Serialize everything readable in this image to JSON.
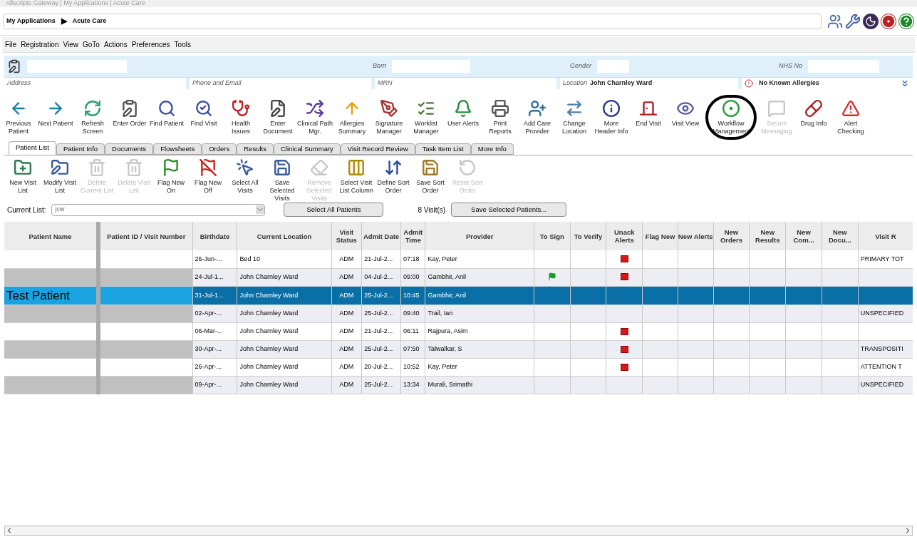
{
  "window": {
    "title": "Allscripts Gateway | My Applications | Acute Care"
  },
  "breadcrumb": {
    "items": [
      "My Applications",
      "Acute Care"
    ],
    "separator": "▶"
  },
  "menu": [
    "File",
    "Registration",
    "View",
    "GoTo",
    "Actions",
    "Preferences",
    "Tools"
  ],
  "patient_header": {
    "row_1": [
      {
        "label": "Born"
      },
      {
        "label": "Gender"
      },
      {
        "label": "NHS No"
      }
    ],
    "row_2": [
      {
        "label": "Address"
      },
      {
        "label": "Phone and Email"
      },
      {
        "label": "MRN"
      },
      {
        "label": "Location",
        "value": "John Charnley Ward"
      }
    ],
    "allergies": "No Known Allergies"
  },
  "toolbar": [
    {
      "label": "Previous Patient",
      "disabled": false
    },
    {
      "label": "Next Patient",
      "disabled": false
    },
    {
      "label": "Refresh Screen",
      "disabled": false
    },
    {
      "label": "Enter Order",
      "disabled": false
    },
    {
      "label": "Find Patient",
      "disabled": false
    },
    {
      "label": "Find Visit",
      "disabled": false
    },
    {
      "label": "Health Issues",
      "disabled": false
    },
    {
      "label": "Enter Document",
      "disabled": false
    },
    {
      "label": "Clinical Path Mgr.",
      "disabled": false
    },
    {
      "label": "Allergies Summary",
      "disabled": false
    },
    {
      "label": "Signature Manager",
      "disabled": false
    },
    {
      "label": "Worklist Manager",
      "disabled": false
    },
    {
      "label": "User Alerts",
      "disabled": false
    },
    {
      "label": "Print Reports",
      "disabled": false
    },
    {
      "label": "Add Care Provider",
      "disabled": false
    },
    {
      "label": "Change Location",
      "disabled": false
    },
    {
      "label": "More Header Info",
      "disabled": false
    },
    {
      "label": "End Visit",
      "disabled": false
    },
    {
      "label": "Visit View",
      "disabled": false
    },
    {
      "label": "Workflow Management",
      "disabled": false
    },
    {
      "label": "Secure Messaging",
      "disabled": true
    },
    {
      "label": "Drug Info",
      "disabled": false
    },
    {
      "label": "Alert Checking",
      "disabled": false
    }
  ],
  "tabs": [
    {
      "label": "Patient List",
      "selected": true
    },
    {
      "label": "Patient Info",
      "selected": false
    },
    {
      "label": "Documents",
      "selected": false
    },
    {
      "label": "Flowsheets",
      "selected": false
    },
    {
      "label": "Orders",
      "selected": false
    },
    {
      "label": "Results",
      "selected": false
    },
    {
      "label": "Clinical Summary",
      "selected": false
    },
    {
      "label": "Visit Record Review",
      "selected": false
    },
    {
      "label": "Task Item List",
      "selected": false
    },
    {
      "label": "More Info",
      "selected": false
    }
  ],
  "list_toolbar": [
    {
      "label": "New Visit List",
      "disabled": false
    },
    {
      "label": "Modify Visit List",
      "disabled": false
    },
    {
      "label": "Delete Current List",
      "disabled": true
    },
    {
      "label": "Delete Visit List",
      "disabled": true
    },
    {
      "label": "Flag New On",
      "disabled": false
    },
    {
      "label": "Flag New Off",
      "disabled": false
    },
    {
      "label": "Select All Visits",
      "disabled": false
    },
    {
      "label": "Save Selected Visits",
      "disabled": false
    },
    {
      "label": "Remove Selected Visits",
      "disabled": true
    },
    {
      "label": "Select Visit List Column",
      "disabled": false
    },
    {
      "label": "Define Sort Order",
      "disabled": false
    },
    {
      "label": "Save Sort Order",
      "disabled": false
    },
    {
      "label": "Reset Sort Order",
      "disabled": true
    }
  ],
  "current_list": {
    "label": "Current List:",
    "value": "jcw"
  },
  "select_all_button": "Select All Patients",
  "visit_count": "8 Visit(s)",
  "save_selected_button": "Save Selected Patients...",
  "table": {
    "columns": [
      "Patient Name",
      "Patient ID / Visit Number",
      "Birthdate",
      "Current Location",
      "Visit Status",
      "Admit Date",
      "Admit Time",
      "Provider",
      "To Sign",
      "To Verify",
      "Unack Alerts",
      "Flag New",
      "New Alerts",
      "New Orders",
      "New Results",
      "New Com...",
      "New Docu...",
      "Visit R"
    ],
    "rows": [
      {
        "selected": false,
        "birthdate": "26-Jun-...",
        "location": "Bed 10",
        "status": "ADM",
        "admit_date": "21-Jul-2...",
        "admit_time": "07:18",
        "provider": "Kay, Peter",
        "to_sign": false,
        "unack_alert": true,
        "visit_reason": "PRIMARY TOT"
      },
      {
        "selected": false,
        "birthdate": "24-Jul-1...",
        "location": "John Charnley Ward",
        "status": "ADM",
        "admit_date": "04-Jul-2...",
        "admit_time": "09:00",
        "provider": "Gambhir, Anil",
        "to_sign": true,
        "unack_alert": true
      },
      {
        "selected": true,
        "patient_name": "Test Patient",
        "birthdate": "31-Jul-1...",
        "location": "John Charnley Ward",
        "status": "ADM",
        "admit_date": "25-Jul-2...",
        "admit_time": "10:45",
        "provider": "Gambhir, Anil",
        "to_sign": false,
        "unack_alert": false
      },
      {
        "selected": false,
        "birthdate": "02-Apr-...",
        "location": "John Charnley Ward",
        "status": "ADM",
        "admit_date": "25-Jul-2...",
        "admit_time": "09:40",
        "provider": "Trail, Ian",
        "to_sign": false,
        "unack_alert": false,
        "visit_reason": "UNSPECIFIED"
      },
      {
        "selected": false,
        "birthdate": "06-Mar-...",
        "location": "John Charnley Ward",
        "status": "ADM",
        "admit_date": "21-Jul-2...",
        "admit_time": "06:11",
        "provider": "Rajpura, Asim",
        "to_sign": false,
        "unack_alert": true
      },
      {
        "selected": false,
        "birthdate": "30-Apr-...",
        "location": "John Charnley Ward",
        "status": "ADM",
        "admit_date": "25-Jul-2...",
        "admit_time": "07:50",
        "provider": "Talwalkar, S",
        "to_sign": false,
        "unack_alert": true,
        "visit_reason": "TRANSPOSITI"
      },
      {
        "selected": false,
        "birthdate": "26-Apr-...",
        "location": "John Charnley Ward",
        "status": "ADM",
        "admit_date": "20-Jul-2...",
        "admit_time": "10:52",
        "provider": "Kay, Peter",
        "to_sign": false,
        "unack_alert": true,
        "visit_reason": "ATTENTION T"
      },
      {
        "selected": false,
        "birthdate": "09-Apr-...",
        "location": "John Charnley Ward",
        "status": "ADM",
        "admit_date": "25-Jul-2...",
        "admit_time": "13:34",
        "provider": "Murali, Srimathi",
        "to_sign": false,
        "unack_alert": false,
        "visit_reason": "UNSPECIFIED"
      }
    ]
  }
}
